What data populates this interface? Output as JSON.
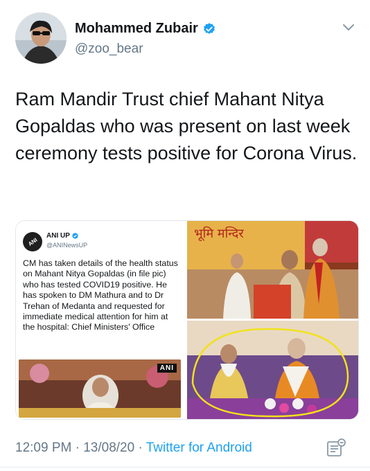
{
  "author": {
    "name": "Mohammed Zubair",
    "handle": "@zoo_bear"
  },
  "tweet": {
    "text": "Ram Mandir Trust chief Mahant Nitya Gopaldas who was present on last week ceremony tests positive for Corona Virus."
  },
  "embedded": {
    "account_name": "ANI UP",
    "account_handle": "@ANINewsUP",
    "logo_text": "ANI",
    "body": "CM has taken details of the health status on Mahant Nitya Gopaldas (in file pic) who has tested COVID19 positive. He has spoken to DM Mathura and to Dr Trehan of Medanta and requested for immediate medical attention for him at the hospital: Chief Ministers' Office",
    "video_watermark": "ANI"
  },
  "footer": {
    "time": "12:09 PM · 13/08/20 · ",
    "source": "Twitter for Android"
  },
  "colors": {
    "verified": "#1da1f2",
    "accent": "#1da1f2",
    "secondary_text": "#657786"
  },
  "icons": {
    "verified": "verified-badge-icon",
    "more": "chevron-down-icon",
    "analytics": "analytics-icon"
  }
}
